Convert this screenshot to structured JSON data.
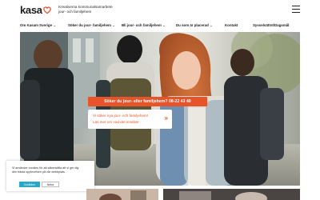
{
  "header": {
    "logo_text": "kasa",
    "tagline_line1": "Kreativerna kommunalsamarbete",
    "tagline_line2": "jour- och familjehem",
    "menu_icon": "hamburger-icon"
  },
  "nav": {
    "items": [
      {
        "label": "Om Kasam Sverige",
        "has_dropdown": true
      },
      {
        "label": "Söker du jour- familjehem",
        "has_dropdown": true
      },
      {
        "label": "Bli jour- och familjehem",
        "has_dropdown": true
      },
      {
        "label": "Du som är placerad",
        "has_dropdown": true
      },
      {
        "label": "Kontakt",
        "has_dropdown": false
      },
      {
        "label": "Sysselsättnt/Dagsmål",
        "has_dropdown": false
      }
    ]
  },
  "hero": {
    "cta_main": "Söker du jour- eller familjehem? 08-22 43 40",
    "cta_card_line1": "Vi söker nya jour- och familjehem!",
    "cta_card_line2": "Läs mer om vad det innebär",
    "cta_card_arrow": "»"
  },
  "cookie": {
    "line1": "Vi använder cookies för att säkerställa att vi ger dig",
    "line2": "den bästa upplevelsen på vår webbplats.",
    "accept_label": "Godkänn",
    "reject_label": "Neka"
  },
  "colors": {
    "accent": "#e8542a",
    "cookie_button": "#28a8c9"
  }
}
